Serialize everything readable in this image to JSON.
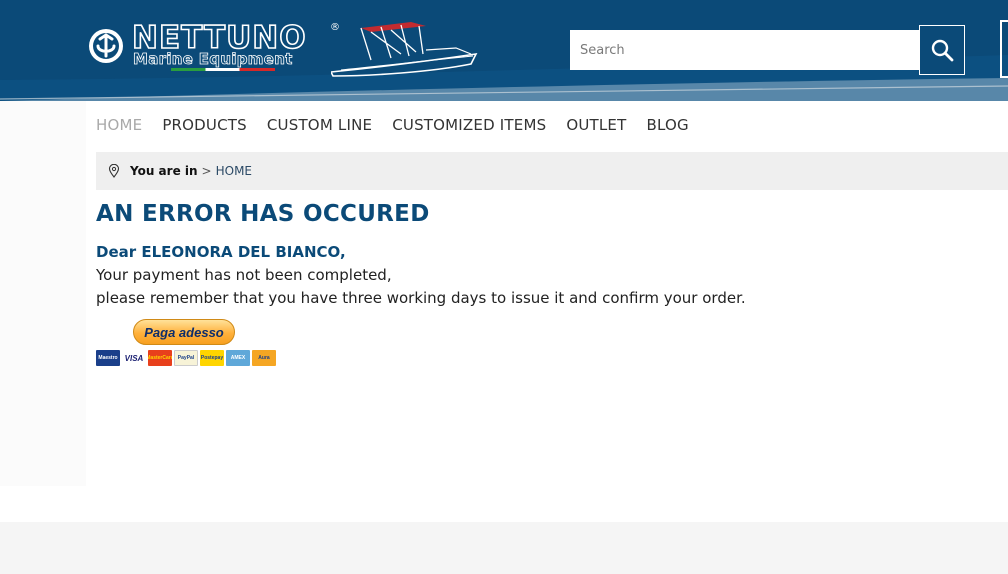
{
  "header": {
    "brand_name": "NETTUNO",
    "brand_registered": "®",
    "brand_subtitle": "Marine Equipment",
    "search_placeholder": "Search",
    "search_value": "",
    "search_icon": "search-icon",
    "colors": {
      "primary": "#0b4a78",
      "accent_red": "#d62828",
      "accent_green": "#2a9d3f"
    }
  },
  "nav": {
    "items": [
      {
        "label": "HOME",
        "active": true
      },
      {
        "label": "PRODUCTS",
        "active": false
      },
      {
        "label": "CUSTOM LINE",
        "active": false
      },
      {
        "label": "CUSTOMIZED ITEMS",
        "active": false
      },
      {
        "label": "OUTLET",
        "active": false
      },
      {
        "label": "BLOG",
        "active": false
      }
    ]
  },
  "breadcrumb": {
    "icon": "map-pin-icon",
    "prefix": "You are in",
    "separator": ">",
    "current": "HOME"
  },
  "content": {
    "title": "AN ERROR HAS OCCURED",
    "greeting": "Dear ELEONORA DEL BIANCO,",
    "line1": "Your payment has not been completed,",
    "line2": "please remember that you have three working days to issue it and confirm your order.",
    "pay_button": "Paga adesso"
  },
  "payment_cards": [
    {
      "name": "maestro-card-icon",
      "text": "Maestro",
      "bg": "#1a3f8a",
      "fg": "#ffffff"
    },
    {
      "name": "visa-card-icon",
      "text": "VISA",
      "bg": "#ffffff",
      "fg": "#1a1f71"
    },
    {
      "name": "mastercard-card-icon",
      "text": "MasterCard",
      "bg": "#e8401c",
      "fg": "#ffd700"
    },
    {
      "name": "paypal-card-icon",
      "text": "PayPal",
      "bg": "#f7f3d7",
      "fg": "#1a3f8a"
    },
    {
      "name": "postepay-card-icon",
      "text": "Postepay",
      "bg": "#ffd500",
      "fg": "#1a3f8a"
    },
    {
      "name": "amex-card-icon",
      "text": "AMEX",
      "bg": "#5fa8d9",
      "fg": "#ffffff"
    },
    {
      "name": "aura-card-icon",
      "text": "Aura",
      "bg": "#f5a623",
      "fg": "#1a3f8a"
    }
  ]
}
